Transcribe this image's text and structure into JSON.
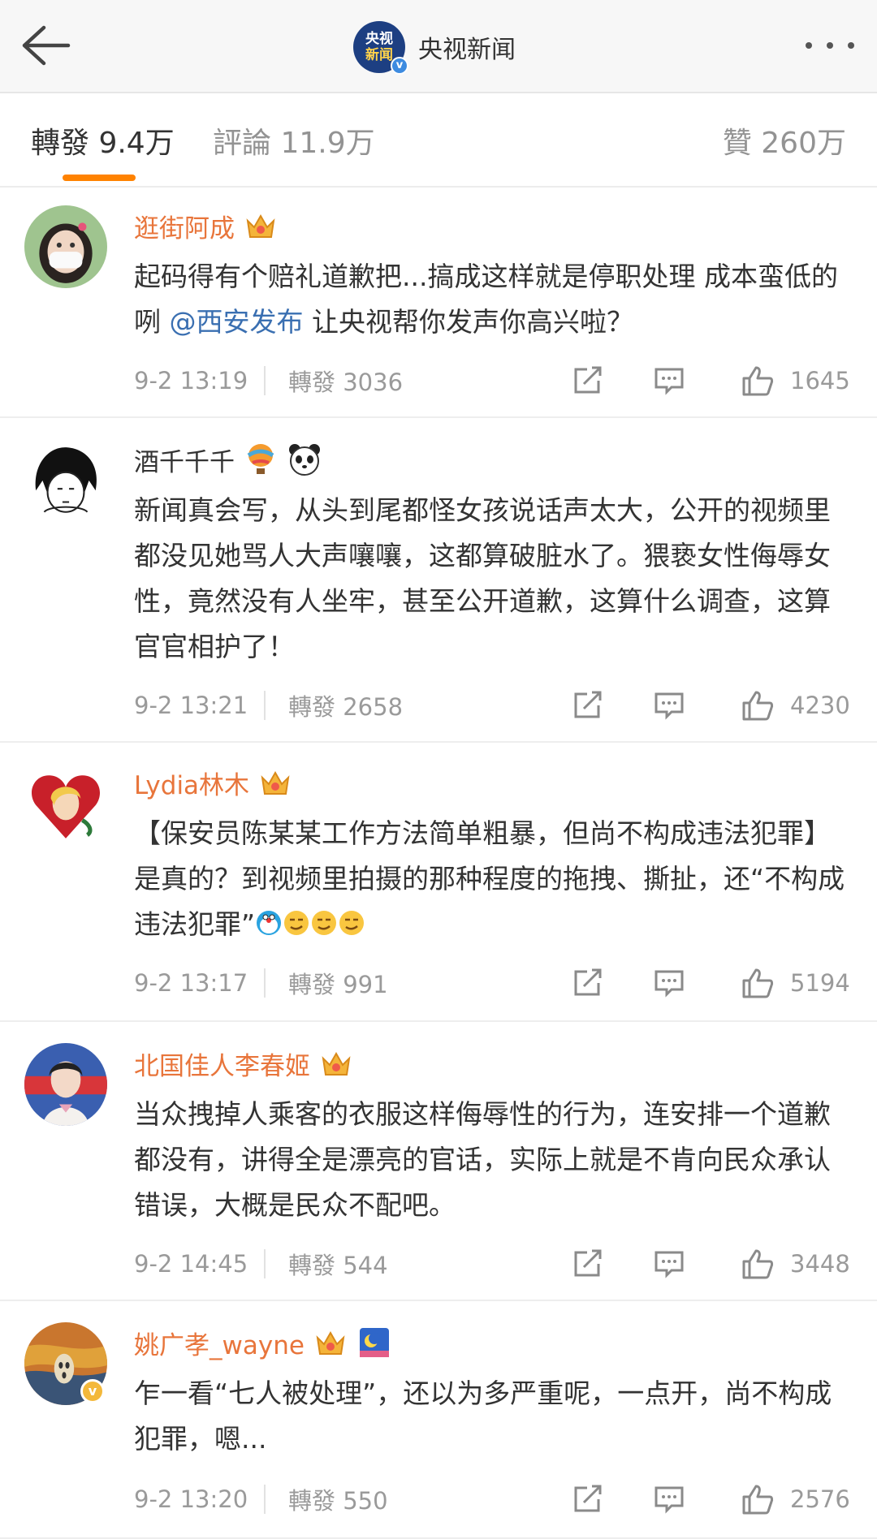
{
  "header": {
    "avatar_text_line1": "央视",
    "avatar_text_line2": "新闻",
    "verified_mark": "v",
    "title": "央视新闻",
    "back_icon": "arrow-left-icon",
    "more_icon": "more-dots-icon"
  },
  "tabs": {
    "repost": "轉發 9.4万",
    "comment": "評論 11.9万",
    "like": "贊 260万",
    "active": "repost",
    "accent": "#ff8200"
  },
  "colors": {
    "vip_name": "#e8753b",
    "mention": "#3a6fb1",
    "meta": "#9a9a9a"
  },
  "comments": [
    {
      "username": "逛街阿成",
      "text_before": "起码得有个赔礼道歉把...搞成这样就是停职处理 成本蛮低的咧 ",
      "mention": "@西安发布",
      "text_after": " 让央视帮你发声你高兴啦？",
      "time": "9-2 13:19",
      "repost": "轉發 3036",
      "likes": "1645",
      "badges": [
        "crown-badge-icon"
      ]
    },
    {
      "username": "酒千千千",
      "text": "新闻真会写，从头到尾都怪女孩说话声太大，公开的视频里都没见她骂人大声嚷嚷，这都算破脏水了。猥亵女性侮辱女性，竟然没有人坐牢，甚至公开道歉，这算什么调查，这算官官相护了！",
      "time": "9-2 13:21",
      "repost": "轉發 2658",
      "likes": "4230",
      "badges": [
        "hot-air-balloon-icon",
        "panda-icon"
      ]
    },
    {
      "username": "Lydia林木",
      "text": "【保安员陈某某工作方法简单粗暴，但尚不构成违法犯罪】是真的？到视频里拍摄的那种程度的拖拽、撕扯，还“不构成违法犯罪”",
      "time": "9-2 13:17",
      "repost": "轉發 991",
      "likes": "5194",
      "badges": [
        "crown-badge-icon"
      ],
      "emojis": [
        "doraemon-emoji",
        "smirk-emoji",
        "smirk-emoji",
        "smirk-emoji"
      ]
    },
    {
      "username": "北国佳人李春姬",
      "text": "当众拽掉人乘客的衣服这样侮辱性的行为，连安排一个道歉都没有，讲得全是漂亮的官话，实际上就是不肯向民众承认错误，大概是民众不配吧。",
      "time": "9-2 14:45",
      "repost": "轉發 544",
      "likes": "3448",
      "badges": [
        "crown-badge-icon"
      ]
    },
    {
      "username": "姚广孝_wayne",
      "text": "乍一看“七人被处理”，还以为多严重呢，一点开，尚不构成犯罪，嗯...",
      "time": "9-2 13:20",
      "repost": "轉發 550",
      "likes": "2576",
      "badges": [
        "crown-badge-icon",
        "night-sky-badge-icon"
      ],
      "verified_mark": "v"
    }
  ]
}
